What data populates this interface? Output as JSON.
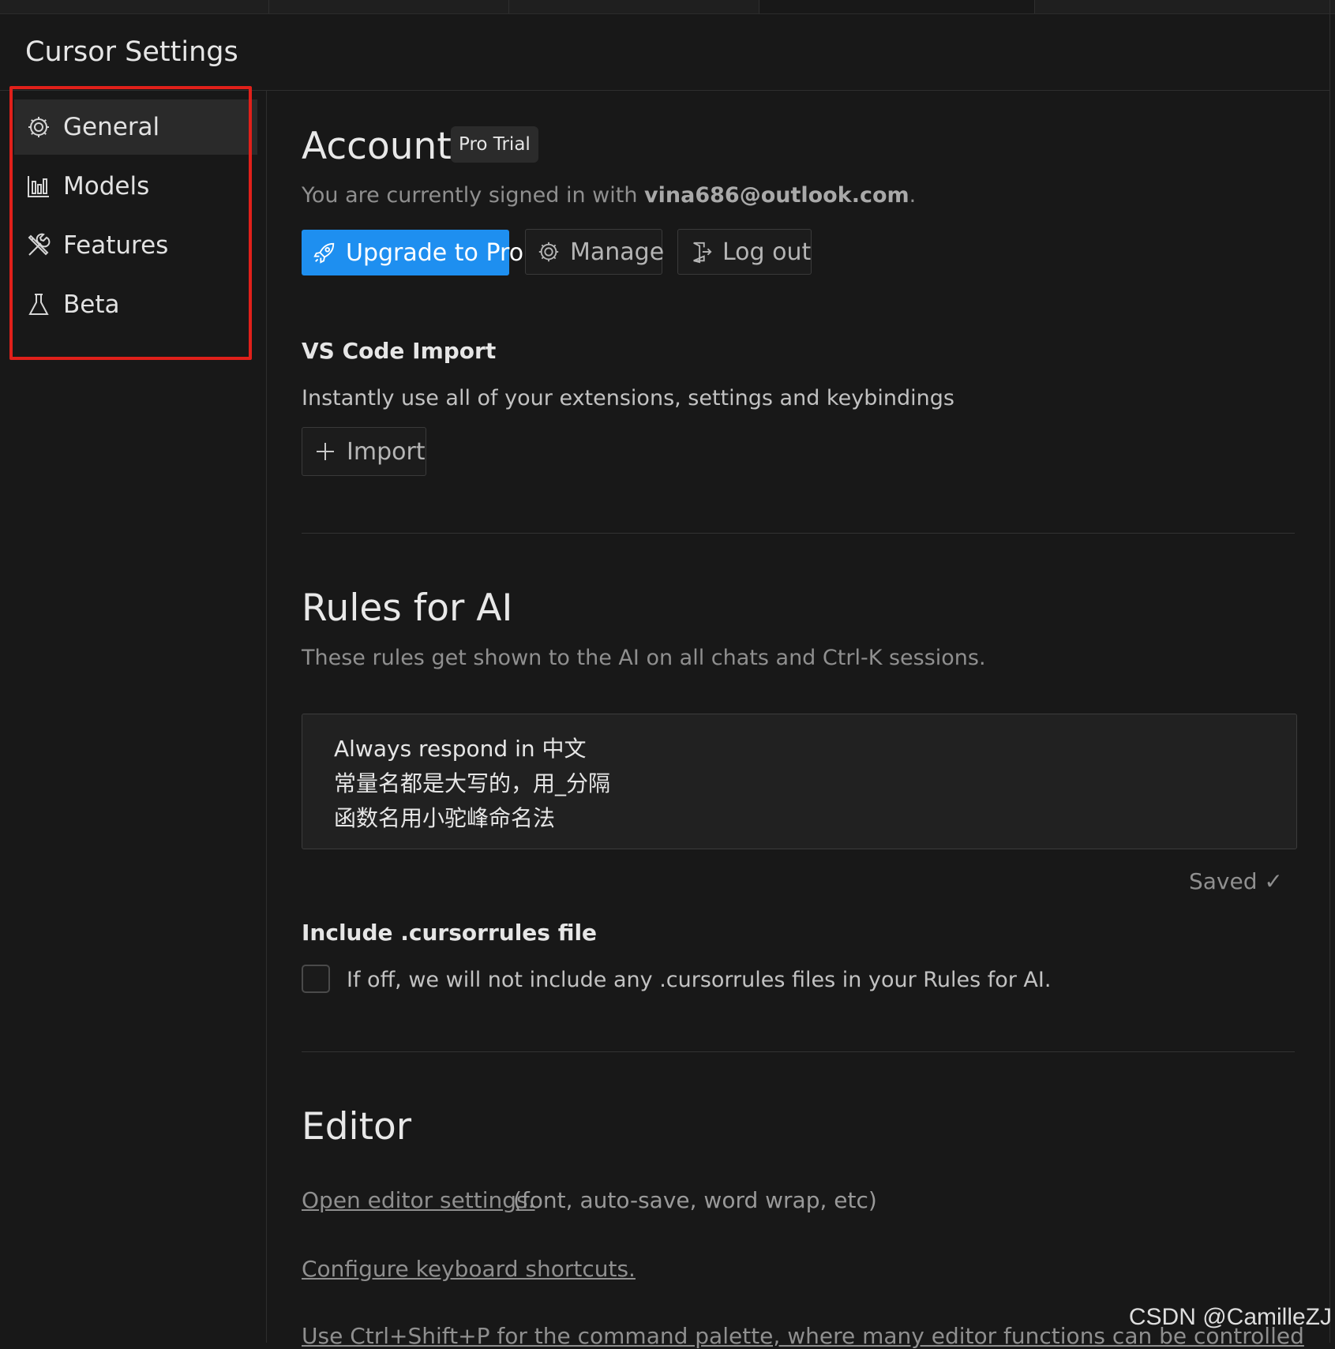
{
  "page_title": "Cursor Settings",
  "sidebar": {
    "items": [
      {
        "label": "General",
        "icon": "gear-icon"
      },
      {
        "label": "Models",
        "icon": "bar-chart-icon"
      },
      {
        "label": "Features",
        "icon": "tools-icon"
      },
      {
        "label": "Beta",
        "icon": "flask-icon"
      }
    ]
  },
  "account": {
    "title": "Account",
    "badge": "Pro Trial",
    "signed_in_prefix": "You are currently signed in with ",
    "email": "vina686@outlook.com",
    "signed_in_suffix": ".",
    "upgrade_label": "Upgrade to Pro",
    "manage_label": "Manage",
    "logout_label": "Log out"
  },
  "vscode_import": {
    "title": "VS Code Import",
    "description": "Instantly use all of your extensions, settings and keybindings",
    "import_label": "Import"
  },
  "rules": {
    "title": "Rules for AI",
    "description": "These rules get shown to the AI on all chats and Ctrl-K sessions.",
    "lines": [
      "Always respond in 中文",
      "常量名都是大写的，用_分隔",
      "函数名用小驼峰命名法"
    ],
    "saved_label": "Saved ✓",
    "cursorrules_title": "Include .cursorrules file",
    "cursorrules_desc": "If off, we will not include any .cursorrules files in your Rules for AI."
  },
  "editor": {
    "title": "Editor",
    "open_settings_link": "Open editor settings.",
    "open_settings_tail": " (font, auto-save, word wrap, etc)",
    "keyboard_link": "Configure keyboard shortcuts.",
    "command_palette_text": "Use Ctrl+Shift+P for the command palette, where many editor functions can be controlled"
  },
  "watermark": "CSDN @CamilleZJ",
  "colors": {
    "background": "#181818",
    "accent": "#1e8ff0",
    "highlight_border": "#e0201a"
  }
}
